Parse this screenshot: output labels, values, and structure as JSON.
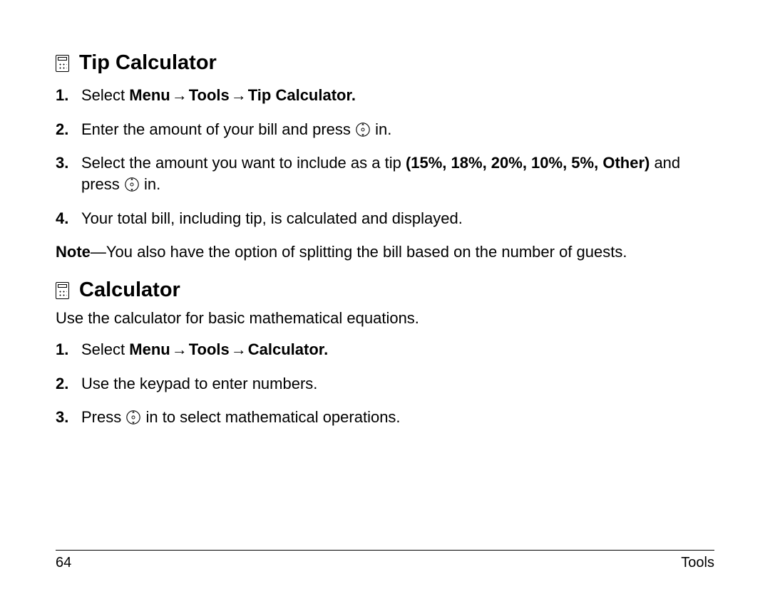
{
  "tip": {
    "heading": "Tip Calculator",
    "step1_prefix": "Select ",
    "step1_b1": "Menu",
    "step1_b2": "Tools",
    "step1_b3": "Tip Calculator.",
    "step2_a": "Enter the amount of your bill and press ",
    "step2_b": " in.",
    "step3_a": "Select the amount you want to include as a tip ",
    "step3_bold": "(15%, 18%, 20%, 10%, 5%, Other)",
    "step3_b": " and press ",
    "step3_c": " in.",
    "step4": "Your total bill, including tip, is calculated and displayed.",
    "note_label": "Note",
    "note_text": "—You also have the option of splitting the bill based on the number of guests."
  },
  "calc": {
    "heading": "Calculator",
    "intro": "Use the calculator for basic mathematical equations.",
    "step1_prefix": "Select ",
    "step1_b1": "Menu",
    "step1_b2": "Tools",
    "step1_b3": "Calculator.",
    "step2": "Use the keypad to enter numbers.",
    "step3_a": "Press ",
    "step3_b": " in to select mathematical operations."
  },
  "nums": {
    "n1": "1.",
    "n2": "2.",
    "n3": "3.",
    "n4": "4."
  },
  "arrow": "→",
  "footer": {
    "page": "64",
    "section": "Tools"
  }
}
